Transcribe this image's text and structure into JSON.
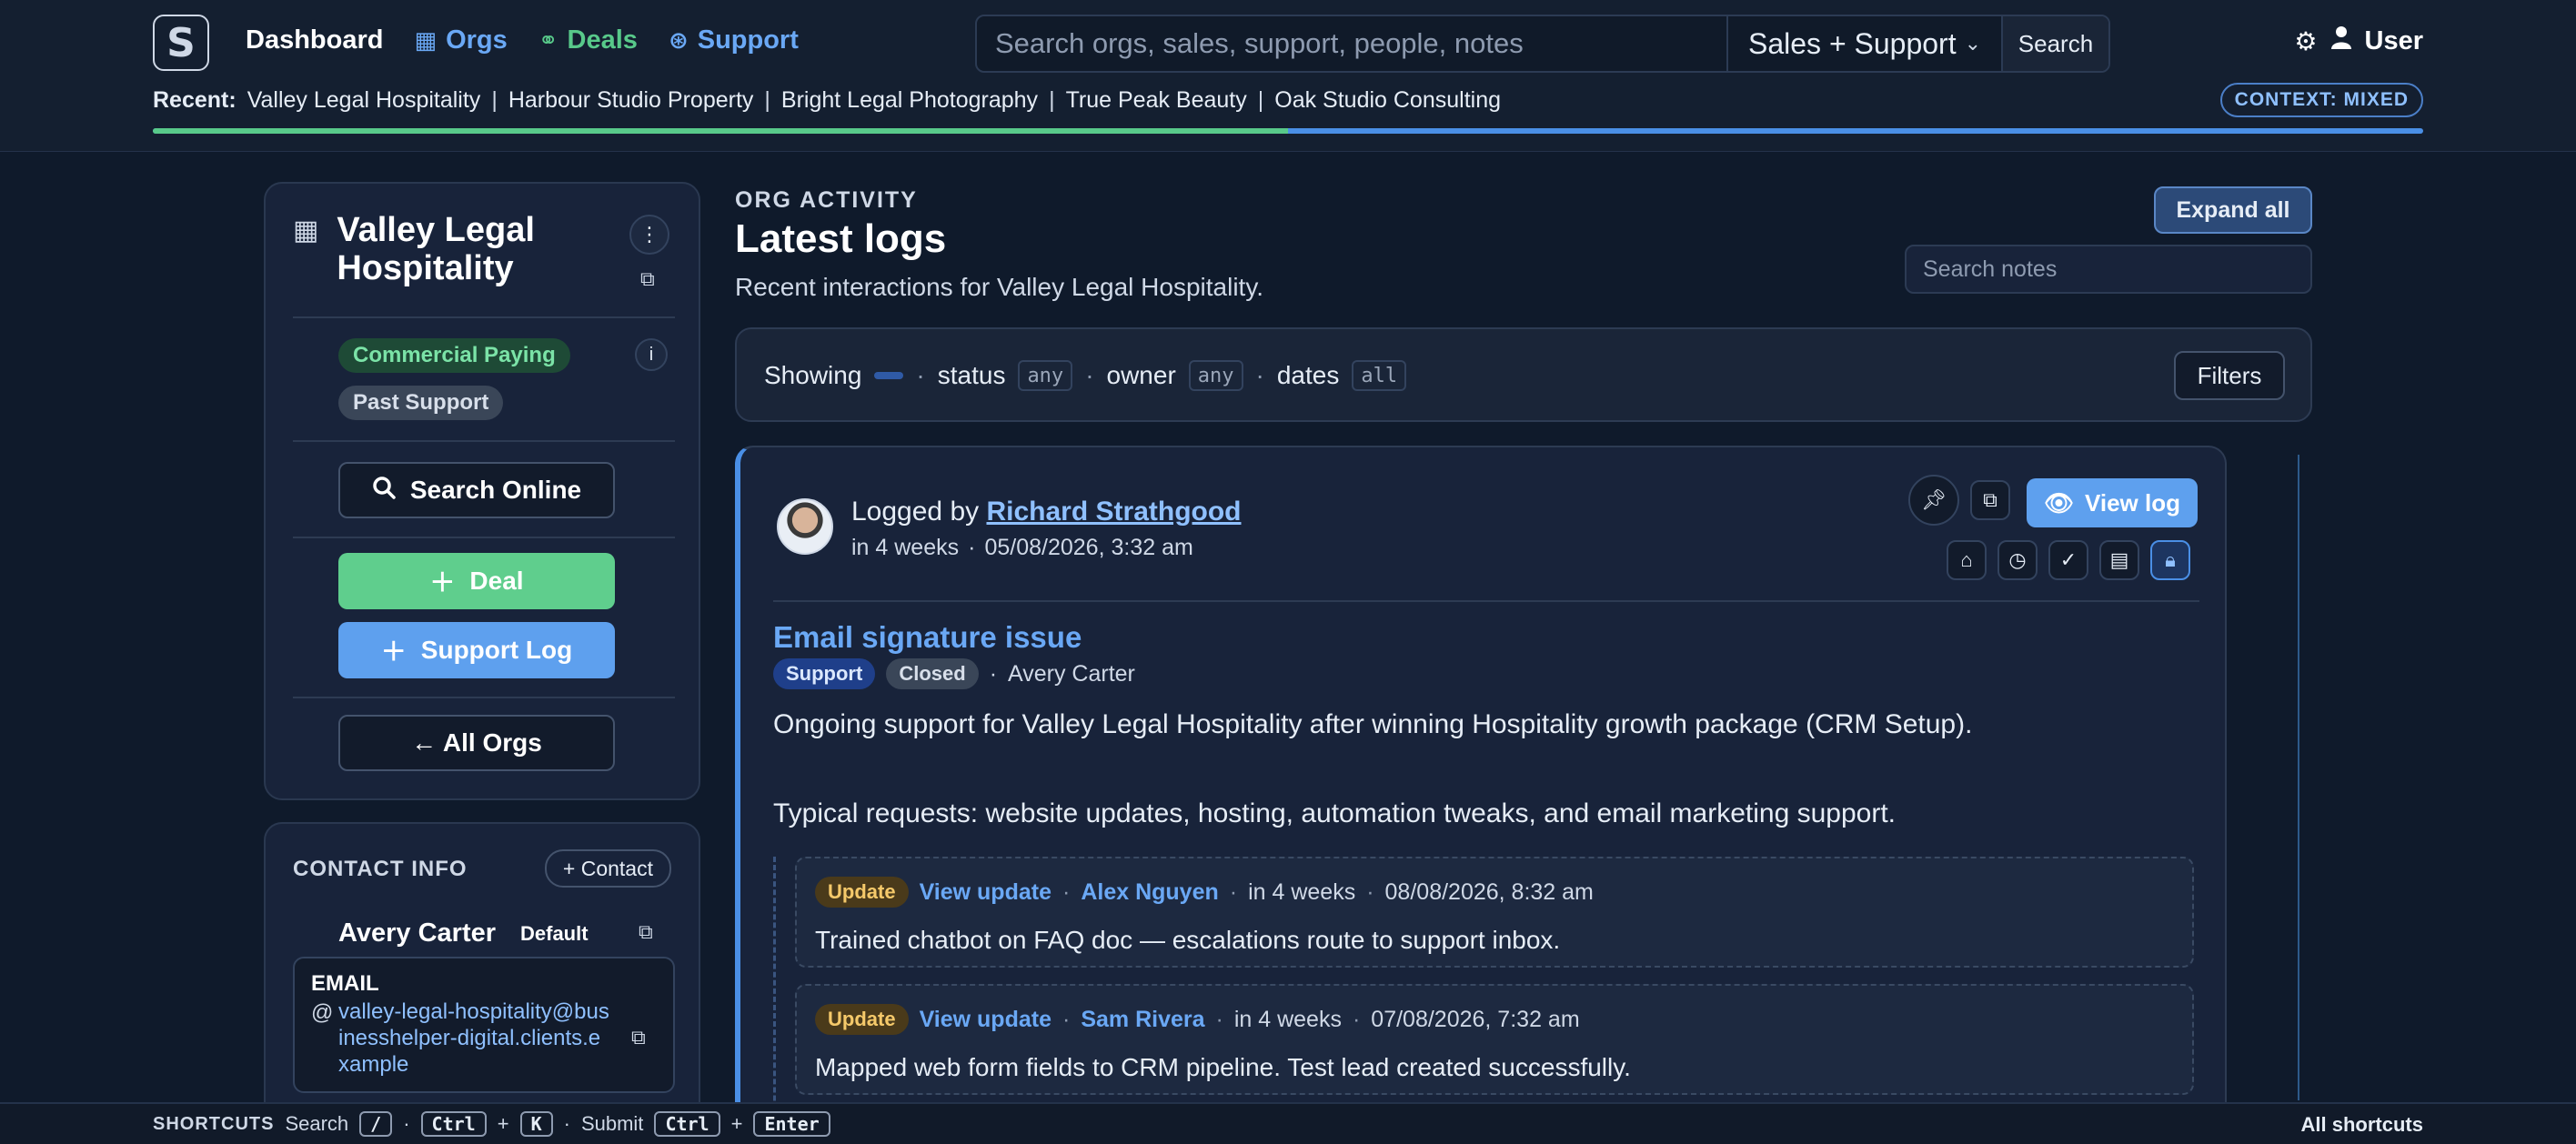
{
  "header": {
    "logo_letter": "S",
    "nav": {
      "dashboard": "Dashboard",
      "orgs": "Orgs",
      "deals": "Deals",
      "support": "Support"
    },
    "search": {
      "placeholder": "Search orgs, sales, support, people, notes",
      "scope": "Sales + Support",
      "button": "Search"
    },
    "user_label": "User",
    "recent_label": "Recent:",
    "recent": [
      "Valley Legal Hospitality",
      "Harbour Studio Property",
      "Bright Legal Photography",
      "True Peak Beauty",
      "Oak Studio Consulting"
    ],
    "context_badge": "CONTEXT: MIXED",
    "progress_fraction": 0.5,
    "colors": {
      "progress_done": "#58c98a",
      "progress_rest": "#4a8fe6"
    }
  },
  "org": {
    "name": "Valley Legal Hospitality",
    "badges": [
      "Commercial Paying",
      "Past Support"
    ],
    "search_online": "Search Online",
    "deal_button": "Deal",
    "support_log_button": "Support Log",
    "all_orgs": "← All Orgs"
  },
  "contact": {
    "title": "CONTACT INFO",
    "add_button": "+ Contact",
    "name": "Avery Carter",
    "default_label": "Default",
    "email_label": "EMAIL",
    "email": "valley-legal-hospitality@businesshelper-digital.clients.example"
  },
  "main": {
    "eyebrow": "ORG ACTIVITY",
    "title": "Latest logs",
    "subtitle": "Recent interactions for Valley Legal Hospitality.",
    "expand_all": "Expand all",
    "notes_placeholder": "Search notes",
    "filters": {
      "showing": "Showing",
      "status_label": "status",
      "status_value": "any",
      "owner_label": "owner",
      "owner_value": "any",
      "dates_label": "dates",
      "dates_value": "all",
      "button": "Filters"
    }
  },
  "log": {
    "logged_by_prefix": "Logged by",
    "author": "Richard Strathgood",
    "relative": "in 4 weeks",
    "datetime": "05/08/2026, 3:32 am",
    "view_log": "View log",
    "title": "Email signature issue",
    "type_tag": "Support",
    "status_tag": "Closed",
    "assignee": "Avery Carter",
    "body_1": "Ongoing support for Valley Legal Hospitality after winning Hospitality growth package (CRM Setup).",
    "body_2": "Typical requests: website updates, hosting, automation tweaks, and email marketing support.",
    "updates": [
      {
        "tag": "Update",
        "link": "View update",
        "author": "Alex Nguyen",
        "relative": "in 4 weeks",
        "datetime": "08/08/2026, 8:32 am",
        "text": "Trained chatbot on FAQ doc — escalations route to support inbox."
      },
      {
        "tag": "Update",
        "link": "View update",
        "author": "Sam Rivera",
        "relative": "in 4 weeks",
        "datetime": "07/08/2026, 7:32 am",
        "text": "Mapped web form fields to CRM pipeline. Test lead created successfully."
      }
    ]
  },
  "footer": {
    "title": "SHORTCUTS",
    "search_label": "Search",
    "key_slash": "/",
    "key_ctrl": "Ctrl",
    "key_k": "K",
    "submit_label": "Submit",
    "key_enter": "Enter",
    "all_shortcuts": "All shortcuts"
  }
}
